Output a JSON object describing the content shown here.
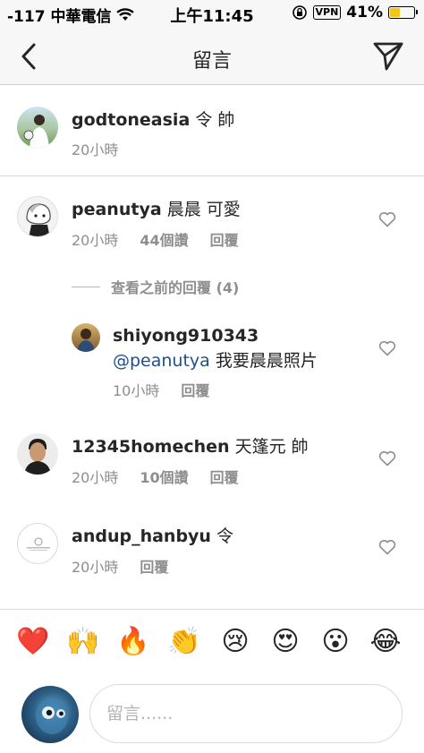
{
  "status_bar": {
    "carrier": "-117 中華電信",
    "time": "上午11:45",
    "vpn": "VPN",
    "battery": "41%",
    "battery_level": 0.41
  },
  "header": {
    "title": "留言",
    "back_icon": "chevron-left-icon",
    "send_icon": "paper-plane-icon"
  },
  "caption": {
    "username": "godtoneasia",
    "text": " 令 帥",
    "time": "20小時"
  },
  "comments": [
    {
      "username": "peanutya",
      "text": " 晨晨 可愛",
      "time": "20小時",
      "likes": "44個讚",
      "reply_label": "回覆",
      "view_replies": "查看之前的回覆 (4)"
    },
    {
      "username": "shiyong910343",
      "mention": "@peanutya",
      "text": " 我要晨晨照片",
      "time": "10小時",
      "reply_label": "回覆"
    },
    {
      "username": "12345homechen",
      "text": " 天篷元  帥",
      "time": "20小時",
      "likes": "10個讚",
      "reply_label": "回覆"
    },
    {
      "username": "andup_hanbyu",
      "text": " 令",
      "time": "20小時",
      "reply_label": "回覆"
    }
  ],
  "emoji_bar": [
    "❤️",
    "🙌",
    "🔥",
    "👏",
    "😢",
    "😍",
    "😮",
    "😂"
  ],
  "composer": {
    "placeholder": "留言......"
  }
}
